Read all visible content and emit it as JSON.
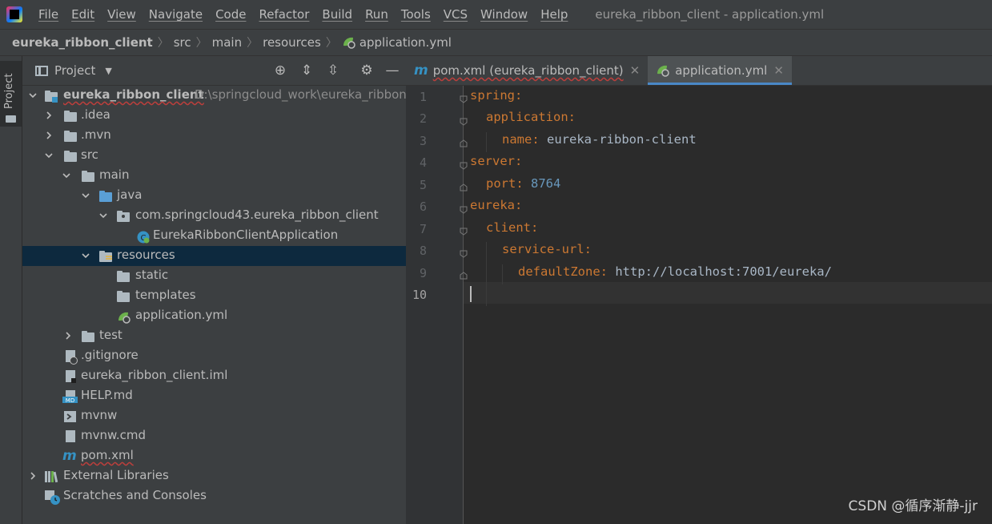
{
  "menubar": {
    "items": [
      "File",
      "Edit",
      "View",
      "Navigate",
      "Code",
      "Refactor",
      "Build",
      "Run",
      "Tools",
      "VCS",
      "Window",
      "Help"
    ],
    "window_title": "eureka_ribbon_client - application.yml"
  },
  "breadcrumb": [
    "eureka_ribbon_client",
    "src",
    "main",
    "resources",
    "application.yml"
  ],
  "side_strip": {
    "project_label": "Project"
  },
  "project_panel": {
    "title": "Project",
    "tree": {
      "root_label": "eureka_ribbon_client",
      "root_path": "D:\\springcloud_work\\eureka_ribbon_",
      "idea": ".idea",
      "mvn": ".mvn",
      "src": "src",
      "main": "main",
      "java": "java",
      "package": "com.springcloud43.eureka_ribbon_client",
      "app_class": "EurekaRibbonClientApplication",
      "resources": "resources",
      "static": "static",
      "templates": "templates",
      "application_yml": "application.yml",
      "test": "test",
      "gitignore": ".gitignore",
      "iml": "eureka_ribbon_client.iml",
      "help_md": "HELP.md",
      "mvnw": "mvnw",
      "mvnw_cmd": "mvnw.cmd",
      "pom": "pom.xml",
      "external_libraries": "External Libraries",
      "scratches": "Scratches and Consoles"
    }
  },
  "editor": {
    "tabs": [
      {
        "label": "pom.xml (eureka_ribbon_client)",
        "active": false
      },
      {
        "label": "application.yml",
        "active": true
      }
    ],
    "line_numbers": [
      "1",
      "2",
      "3",
      "4",
      "5",
      "6",
      "7",
      "8",
      "9",
      "10"
    ],
    "current_line": 10,
    "code": {
      "l1_key": "spring",
      "l2_key": "application",
      "l3_key": "name",
      "l3_val": "eureka-ribbon-client",
      "l4_key": "server",
      "l5_key": "port",
      "l5_val": "8764",
      "l6_key": "eureka",
      "l7_key": "client",
      "l8_key": "service-url",
      "l9_key": "defaultZone",
      "l9_val": "http://localhost:7001/eureka/",
      "colon": ":"
    }
  },
  "watermark": "CSDN @循序渐静-jjr",
  "colors": {
    "background": "#2b2b2b",
    "panel": "#3c3f41",
    "selection": "#0d293e",
    "keyword": "#cc7832",
    "number": "#6897bb",
    "text": "#a9b7c6",
    "accent": "#4a88c7"
  }
}
